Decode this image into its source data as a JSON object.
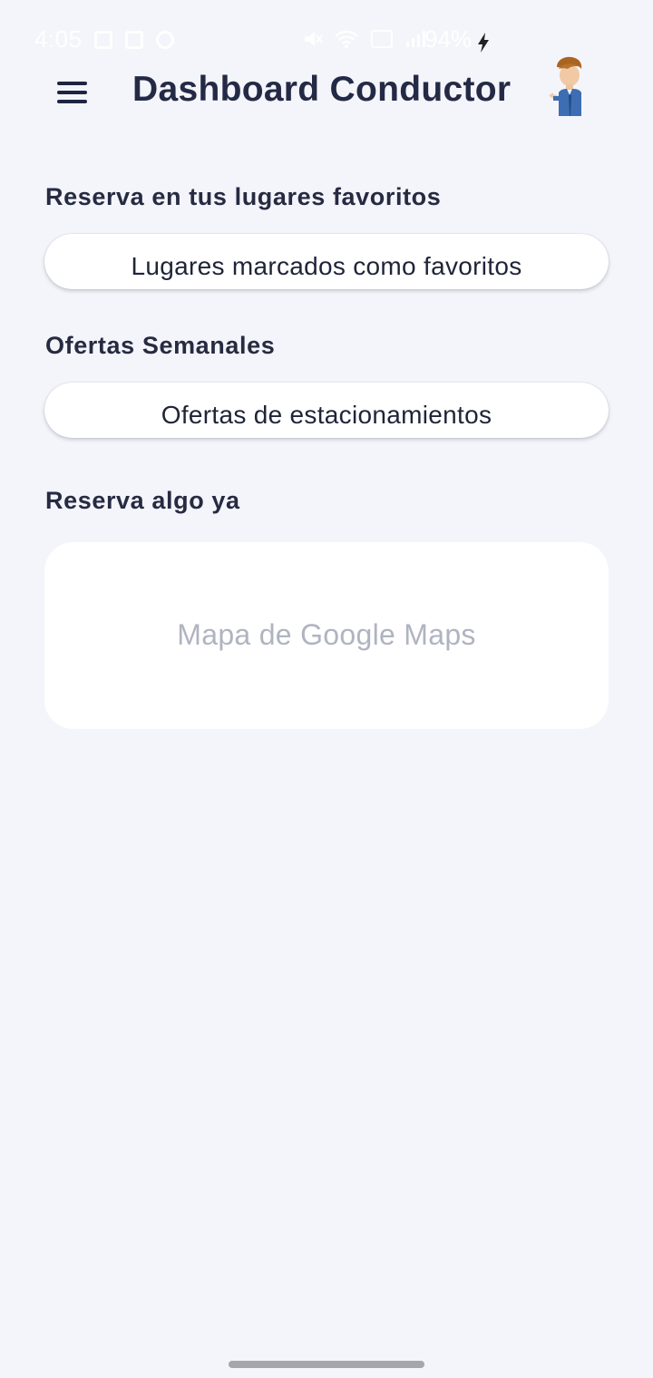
{
  "status_bar": {
    "time": "4:05",
    "battery": "94%"
  },
  "header": {
    "title": "Dashboard Conductor"
  },
  "sections": [
    {
      "label": "Reserva en tus lugares favoritos",
      "button": "Lugares marcados como favoritos"
    },
    {
      "label": "Ofertas Semanales",
      "button": "Ofertas de estacionamientos"
    },
    {
      "label": "Reserva algo ya",
      "placeholder": "Mapa de Google Maps"
    }
  ],
  "colors": {
    "background": "#f4f5fa",
    "title": "#242a45",
    "card": "#ffffff",
    "placeholder_text": "#b0b4c1"
  }
}
